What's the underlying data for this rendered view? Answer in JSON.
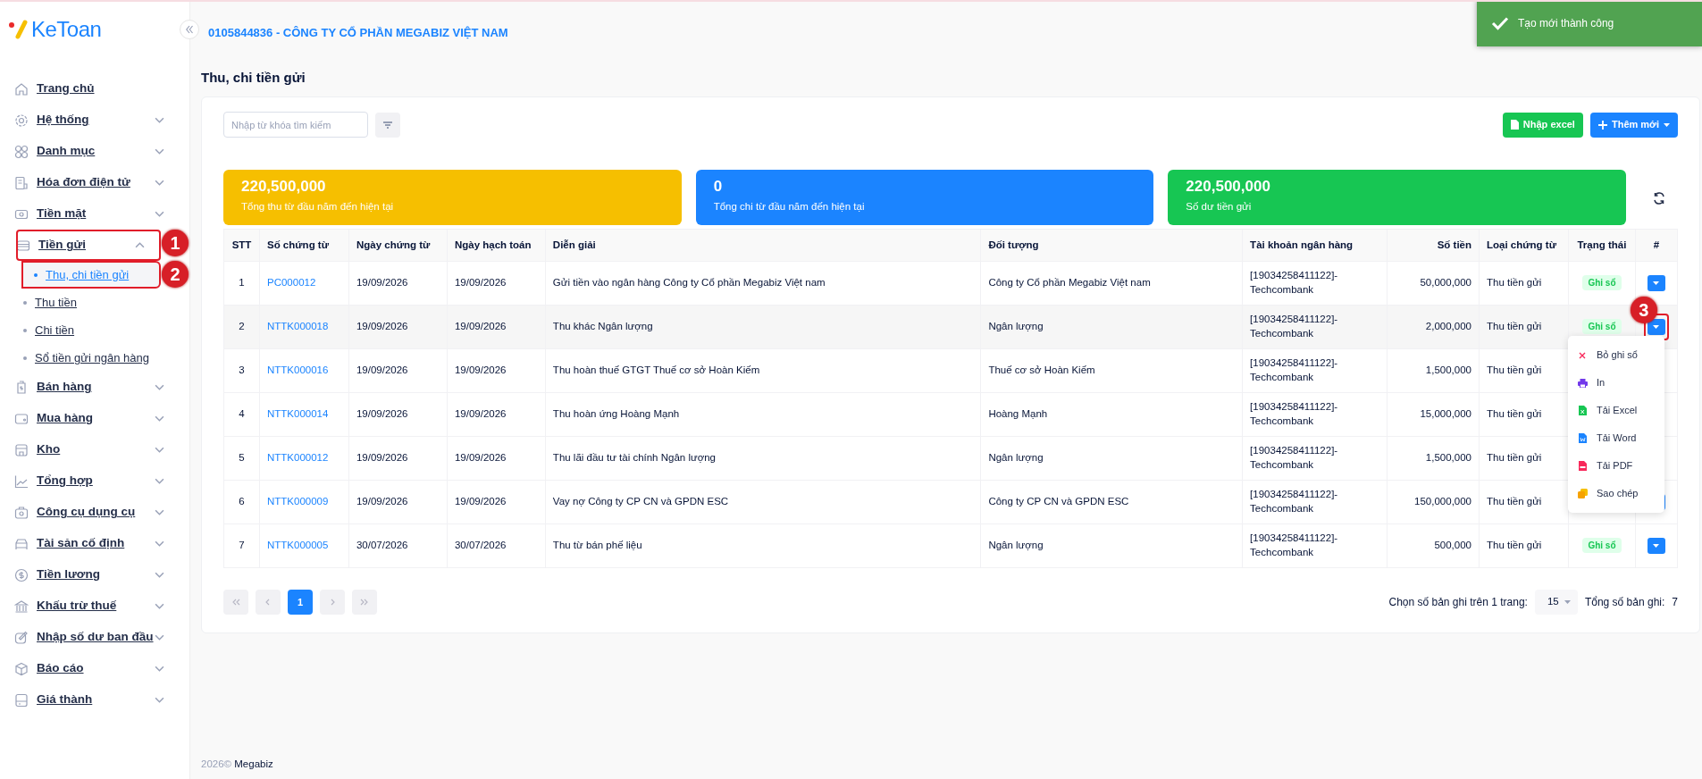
{
  "logo": {
    "text": "KeToan"
  },
  "sidebar": {
    "items": [
      {
        "label": "Trang chủ"
      },
      {
        "label": "Hệ thống",
        "expanded": false
      },
      {
        "label": "Danh mục",
        "expanded": false
      },
      {
        "label": "Hóa đơn điện tử",
        "expanded": false
      },
      {
        "label": "Tiền mặt",
        "expanded": false
      },
      {
        "label": "Tiền gửi",
        "expanded": true,
        "callout": "1",
        "children": [
          {
            "label": "Thu, chi tiền gửi",
            "selected": true,
            "callout": "2"
          },
          {
            "label": "Thu tiền",
            "selected": false
          },
          {
            "label": "Chi tiền",
            "selected": false
          },
          {
            "label": "Sổ tiền gửi ngân hàng",
            "selected": false
          }
        ]
      },
      {
        "label": "Bán hàng",
        "expanded": false
      },
      {
        "label": "Mua hàng",
        "expanded": false
      },
      {
        "label": "Kho",
        "expanded": false
      },
      {
        "label": "Tổng hợp",
        "expanded": false
      },
      {
        "label": "Công cụ dụng cụ",
        "expanded": false
      },
      {
        "label": "Tài sản cố định",
        "expanded": false
      },
      {
        "label": "Tiền lương",
        "expanded": false
      },
      {
        "label": "Khấu trừ thuế",
        "expanded": false
      },
      {
        "label": "Nhập số dư ban đầu",
        "expanded": false
      },
      {
        "label": "Báo cáo",
        "expanded": false
      },
      {
        "label": "Giá thành",
        "expanded": false
      }
    ]
  },
  "header": {
    "company": "0105844836 - CÔNG TY CỔ PHẦN MEGABIZ VIỆT NAM"
  },
  "toast": {
    "message": "Tạo mới thành công"
  },
  "page_title": "Thu, chi tiền gửi",
  "search": {
    "placeholder": "Nhập từ khóa tìm kiếm"
  },
  "buttons": [
    {
      "label": "Nhập excel",
      "kind": "import"
    },
    {
      "label": "Thêm mới",
      "kind": "add"
    }
  ],
  "stats": [
    {
      "value": "220,500,000",
      "label": "Tổng thu từ đầu năm đến hiện tại",
      "color": "#f6bf00"
    },
    {
      "value": "0",
      "label": "Tổng chi từ đầu năm đến hiện tại",
      "color": "#1b84ff"
    },
    {
      "value": "220,500,000",
      "label": "Số dư tiền gửi",
      "color": "#17c653"
    }
  ],
  "table": {
    "columns": [
      "STT",
      "Số chứng từ",
      "Ngày chứng từ",
      "Ngày hạch toán",
      "Diễn giải",
      "Đối tượng",
      "Tài khoản ngân hàng",
      "Số tiền",
      "Loại chứng từ",
      "Trạng thái",
      "#"
    ],
    "rows": [
      {
        "stt": "1",
        "doc": "PC000012",
        "doc_date": "19/09/2026",
        "post_date": "19/09/2026",
        "desc": "Gửi tiền vào ngân hàng Công ty Cổ phần Megabiz Việt nam",
        "party": "Công ty Cổ phần Megabiz Việt nam",
        "account": [
          "[19034258411122]-",
          "Techcombank"
        ],
        "amount": "50,000,000",
        "type": "Thu tiền gửi",
        "status": "Ghi sổ",
        "action_visible": true
      },
      {
        "stt": "2",
        "doc": "NTTK000018",
        "doc_date": "19/09/2026",
        "post_date": "19/09/2026",
        "desc": "Thu khác Ngân lượng",
        "party": "Ngân lượng",
        "account": [
          "[19034258411122]-",
          "Techcombank"
        ],
        "amount": "2,000,000",
        "type": "Thu tiền gửi",
        "status": "Ghi sổ",
        "action_visible": true,
        "callout": "3",
        "menu_open": true
      },
      {
        "stt": "3",
        "doc": "NTTK000016",
        "doc_date": "19/09/2026",
        "post_date": "19/09/2026",
        "desc": "Thu hoàn thuế GTGT Thuế cơ sở Hoàn Kiếm",
        "party": "Thuế cơ sở Hoàn Kiếm",
        "account": [
          "[19034258411122]-",
          "Techcombank"
        ],
        "amount": "1,500,000",
        "type": "Thu tiền gửi",
        "action_visible": false
      },
      {
        "stt": "4",
        "doc": "NTTK000014",
        "doc_date": "19/09/2026",
        "post_date": "19/09/2026",
        "desc": "Thu hoàn ứng Hoàng Mạnh",
        "party": "Hoàng Mạnh",
        "account": [
          "[19034258411122]-",
          "Techcombank"
        ],
        "amount": "15,000,000",
        "type": "Thu tiền gửi",
        "action_visible": false
      },
      {
        "stt": "5",
        "doc": "NTTK000012",
        "doc_date": "19/09/2026",
        "post_date": "19/09/2026",
        "desc": "Thu lãi đầu tư tài chính Ngân lượng",
        "party": "Ngân lượng",
        "account": [
          "[19034258411122]-",
          "Techcombank"
        ],
        "amount": "1,500,000",
        "type": "Thu tiền gửi",
        "action_visible": false
      },
      {
        "stt": "6",
        "doc": "NTTK000009",
        "doc_date": "19/09/2026",
        "post_date": "19/09/2026",
        "desc": "Vay nợ Công ty CP CN và GPDN ESC",
        "party": "Công ty CP CN và GPDN ESC",
        "account": [
          "[19034258411122]-",
          "Techcombank"
        ],
        "amount": "150,000,000",
        "type": "Thu tiền gửi",
        "action_visible": true
      },
      {
        "stt": "7",
        "doc": "NTTK000005",
        "doc_date": "30/07/2026",
        "post_date": "30/07/2026",
        "desc": "Thu từ bán phế liệu",
        "party": "Ngân lượng",
        "account": [
          "[19034258411122]-",
          "Techcombank"
        ],
        "amount": "500,000",
        "type": "Thu tiền gửi",
        "status": "Ghi sổ",
        "action_visible": true
      }
    ]
  },
  "row_menu": {
    "items": [
      {
        "label": "Bỏ ghi sổ",
        "kind": "unpost"
      },
      {
        "label": "In",
        "kind": "print"
      },
      {
        "label": "Tải Excel",
        "kind": "excel"
      },
      {
        "label": "Tải Word",
        "kind": "word"
      },
      {
        "label": "Tải PDF",
        "kind": "pdf"
      },
      {
        "label": "Sao chép",
        "kind": "copy"
      }
    ]
  },
  "pagination": {
    "pages": [
      {
        "label": "1",
        "selected": true
      }
    ],
    "per_page_label": "Chọn số bản ghi trên 1 trang:",
    "per_page": "15",
    "total_label": "Tổng số bản ghi:",
    "total": "7"
  },
  "footer": {
    "year": "2026©",
    "brand": "Megabiz"
  }
}
